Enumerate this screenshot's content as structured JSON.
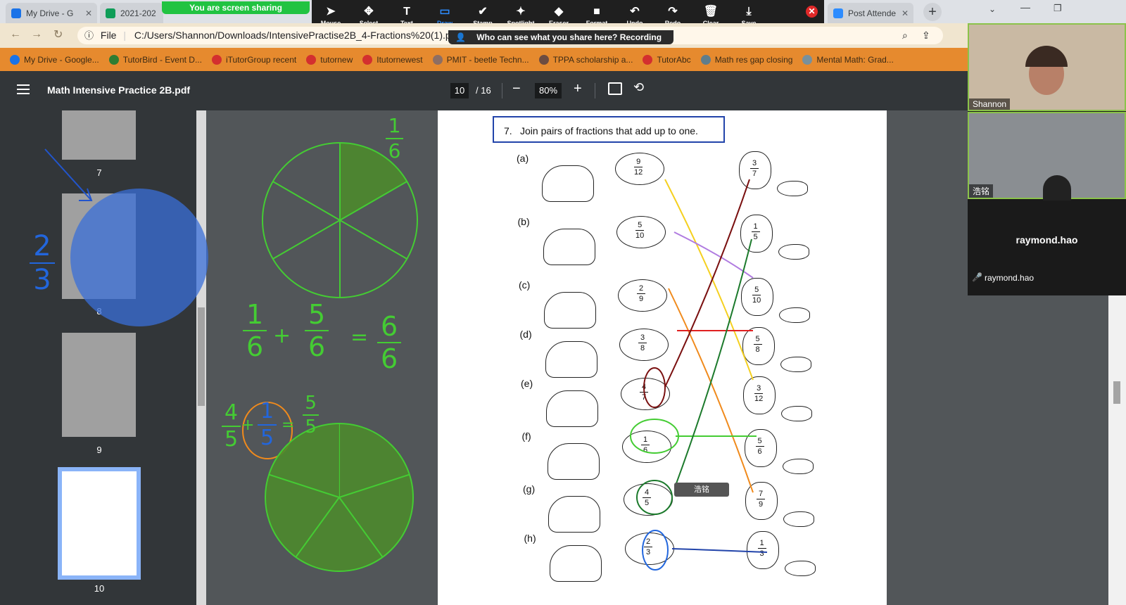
{
  "browser": {
    "tabs": [
      {
        "label": "My Drive - G",
        "color": "#1a73e8"
      },
      {
        "label": "2021-202",
        "color": "#0f9d58"
      },
      {
        "label": "Post Attende",
        "color": "#2d8cff"
      }
    ],
    "new_tab_symbol": "+",
    "address": {
      "file_label": "File",
      "url": "C:/Users/Shannon/Downloads/IntensivePractise2B_4-Fractions%20(1).pdf"
    },
    "bookmarks": [
      {
        "label": "My Drive - Google...",
        "color": "#1a73e8"
      },
      {
        "label": "TutorBird - Event D...",
        "color": "#2e7d32"
      },
      {
        "label": "iTutorGroup recent",
        "color": "#d32f2f"
      },
      {
        "label": "tutornew",
        "color": "#d32f2f"
      },
      {
        "label": "Itutornewest",
        "color": "#d32f2f"
      },
      {
        "label": "PMIT - beetle Techn...",
        "color": "#8d6e63"
      },
      {
        "label": "TPPA scholarship a...",
        "color": "#6d4c41"
      },
      {
        "label": "TutorAbc",
        "color": "#d32f2f"
      },
      {
        "label": "Math res gap closing",
        "color": "#607d8b"
      },
      {
        "label": "Mental Math: Grad...",
        "color": "#78909c"
      }
    ]
  },
  "zoom": {
    "share_banner": "You are screen sharing",
    "recording_banner": "Who can see what you share here? Recording On",
    "tools": [
      {
        "label": "Mouse",
        "icon": "cursor-icon",
        "glyph": "➤"
      },
      {
        "label": "Select",
        "icon": "move-icon",
        "glyph": "✥"
      },
      {
        "label": "Text",
        "icon": "text-icon",
        "glyph": "T"
      },
      {
        "label": "Draw",
        "icon": "rectangle-icon",
        "glyph": "▭"
      },
      {
        "label": "Stamp",
        "icon": "checkmark-icon",
        "glyph": "✔"
      },
      {
        "label": "Spotlight",
        "icon": "spotlight-icon",
        "glyph": "✦"
      },
      {
        "label": "Eraser",
        "icon": "eraser-icon",
        "glyph": "◆"
      },
      {
        "label": "Format",
        "icon": "format-icon",
        "glyph": "■"
      },
      {
        "label": "Undo",
        "icon": "undo-icon",
        "glyph": "↶"
      },
      {
        "label": "Redo",
        "icon": "redo-icon",
        "glyph": "↷"
      },
      {
        "label": "Clear",
        "icon": "trash-icon",
        "glyph": "🗑"
      },
      {
        "label": "Save",
        "icon": "save-icon",
        "glyph": "⤓"
      }
    ],
    "active_tool": "Draw",
    "participants": [
      {
        "name": "Shannon"
      },
      {
        "name": "浩铭"
      },
      {
        "name": "raymond.hao",
        "footer": "raymond.hao"
      }
    ],
    "annotation_tag": "浩铭"
  },
  "pdf": {
    "title": "Math Intensive Practice 2B.pdf",
    "current_page": "10",
    "total_pages": "/ 16",
    "zoom": "80%",
    "thumbnails": [
      {
        "page": "7"
      },
      {
        "page": "8"
      },
      {
        "page": "9"
      },
      {
        "page": "10",
        "selected": true
      }
    ],
    "question_number": "7.",
    "question_text": "Join pairs of fractions that add up to one.",
    "rows": [
      {
        "label": "(a)",
        "left_num": "9",
        "left_den": "12",
        "right_num": "3",
        "right_den": "7"
      },
      {
        "label": "(b)",
        "left_num": "5",
        "left_den": "10",
        "right_num": "1",
        "right_den": "5"
      },
      {
        "label": "(c)",
        "left_num": "2",
        "left_den": "9",
        "right_num": "5",
        "right_den": "10"
      },
      {
        "label": "(d)",
        "left_num": "3",
        "left_den": "8",
        "right_num": "5",
        "right_den": "8"
      },
      {
        "label": "(e)",
        "left_num": "4",
        "left_den": "7",
        "right_num": "3",
        "right_den": "12"
      },
      {
        "label": "(f)",
        "left_num": "1",
        "left_den": "6",
        "right_num": "5",
        "right_den": "6"
      },
      {
        "label": "(g)",
        "left_num": "4",
        "left_den": "5",
        "right_num": "7",
        "right_den": "9"
      },
      {
        "label": "(h)",
        "left_num": "2",
        "left_den": "3",
        "right_num": "1",
        "right_den": "3"
      }
    ]
  },
  "whiteboard": {
    "top_fraction": {
      "num": "1",
      "den": "6"
    },
    "equation": {
      "a_num": "1",
      "a_den": "6",
      "op": "+",
      "b_num": "5",
      "b_den": "6",
      "eq": "=",
      "c_num": "6",
      "c_den": "6"
    },
    "equation2": {
      "a_num": "4",
      "a_den": "5",
      "op": "+",
      "b_num": "1",
      "b_den": "5",
      "eq": "=",
      "c_num": "5",
      "c_den": "5"
    },
    "side_fraction": {
      "num": "2",
      "den": "3"
    }
  },
  "colors": {
    "pen_green": "#44cc33",
    "pen_blue": "#2266dd",
    "pen_orange": "#f08a1c",
    "accent": "#2d8cff"
  }
}
